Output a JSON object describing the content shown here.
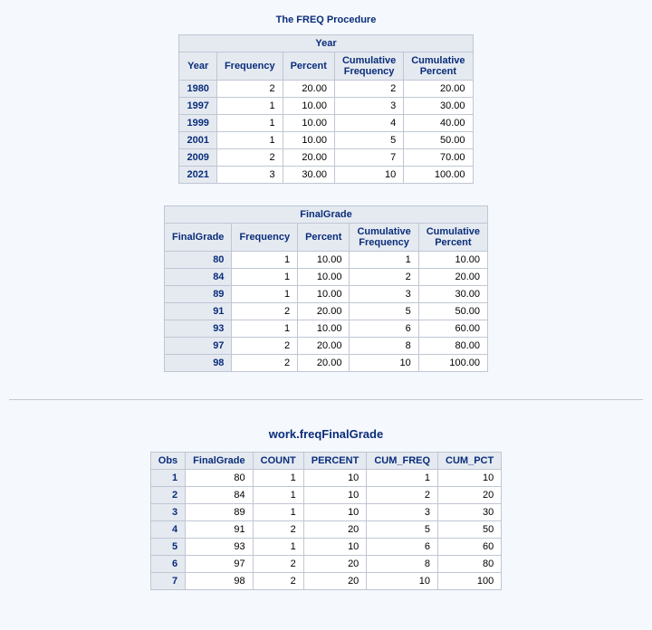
{
  "proc_title": "The FREQ Procedure",
  "year_table": {
    "caption": "Year",
    "headers": [
      "Year",
      "Frequency",
      "Percent",
      "Cumulative\nFrequency",
      "Cumulative\nPercent"
    ],
    "rows": [
      [
        "1980",
        "2",
        "20.00",
        "2",
        "20.00"
      ],
      [
        "1997",
        "1",
        "10.00",
        "3",
        "30.00"
      ],
      [
        "1999",
        "1",
        "10.00",
        "4",
        "40.00"
      ],
      [
        "2001",
        "1",
        "10.00",
        "5",
        "50.00"
      ],
      [
        "2009",
        "2",
        "20.00",
        "7",
        "70.00"
      ],
      [
        "2021",
        "3",
        "30.00",
        "10",
        "100.00"
      ]
    ]
  },
  "grade_table": {
    "caption": "FinalGrade",
    "headers": [
      "FinalGrade",
      "Frequency",
      "Percent",
      "Cumulative\nFrequency",
      "Cumulative\nPercent"
    ],
    "rows": [
      [
        "80",
        "1",
        "10.00",
        "1",
        "10.00"
      ],
      [
        "84",
        "1",
        "10.00",
        "2",
        "20.00"
      ],
      [
        "89",
        "1",
        "10.00",
        "3",
        "30.00"
      ],
      [
        "91",
        "2",
        "20.00",
        "5",
        "50.00"
      ],
      [
        "93",
        "1",
        "10.00",
        "6",
        "60.00"
      ],
      [
        "97",
        "2",
        "20.00",
        "8",
        "80.00"
      ],
      [
        "98",
        "2",
        "20.00",
        "10",
        "100.00"
      ]
    ]
  },
  "ds_title": "work.freqFinalGrade",
  "ds_table": {
    "headers": [
      "Obs",
      "FinalGrade",
      "COUNT",
      "PERCENT",
      "CUM_FREQ",
      "CUM_PCT"
    ],
    "rows": [
      [
        "1",
        "80",
        "1",
        "10",
        "1",
        "10"
      ],
      [
        "2",
        "84",
        "1",
        "10",
        "2",
        "20"
      ],
      [
        "3",
        "89",
        "1",
        "10",
        "3",
        "30"
      ],
      [
        "4",
        "91",
        "2",
        "20",
        "5",
        "50"
      ],
      [
        "5",
        "93",
        "1",
        "10",
        "6",
        "60"
      ],
      [
        "6",
        "97",
        "2",
        "20",
        "8",
        "80"
      ],
      [
        "7",
        "98",
        "2",
        "20",
        "10",
        "100"
      ]
    ]
  }
}
